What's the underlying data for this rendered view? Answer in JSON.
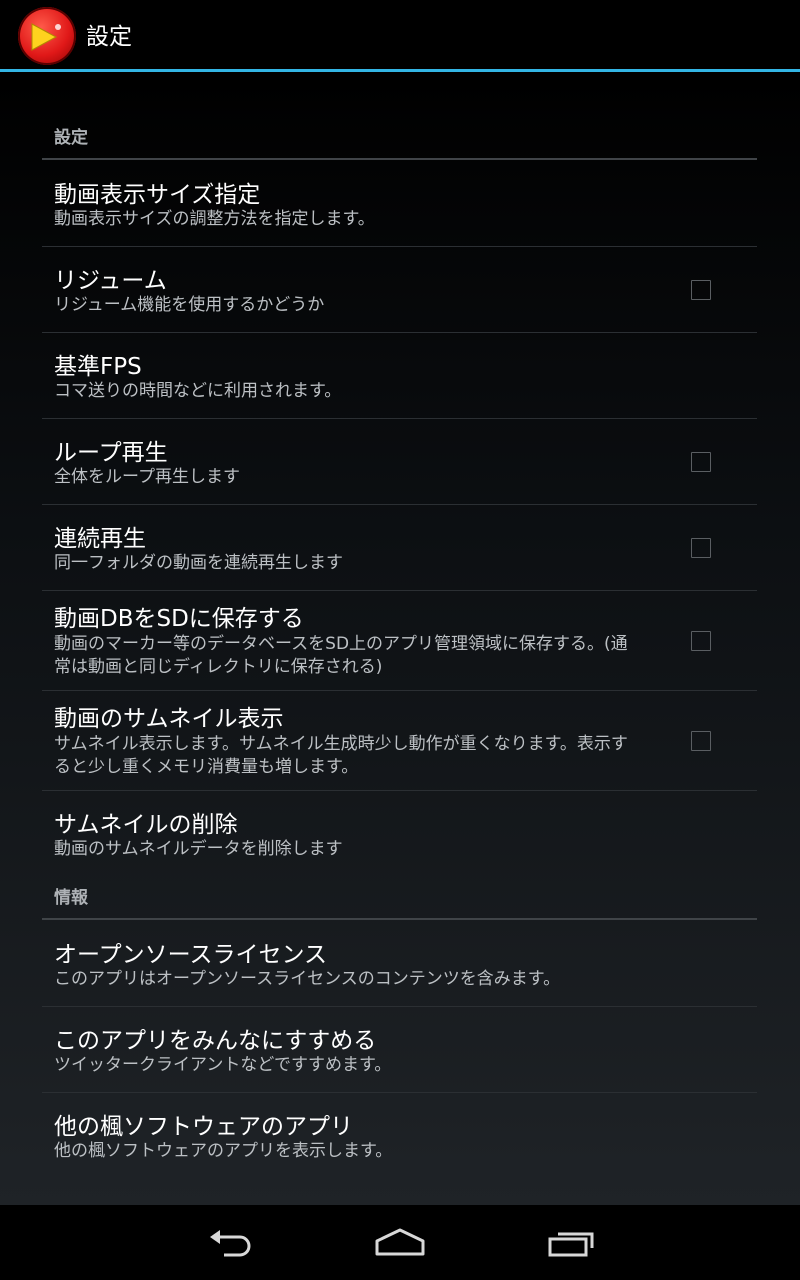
{
  "header": {
    "title": "設定",
    "app_icon": "play-icon",
    "accent_color": "#33b5e5"
  },
  "categories": [
    {
      "label": "設定"
    },
    {
      "label": "情報"
    }
  ],
  "items": [
    {
      "title": "動画表示サイズ指定",
      "summary": "動画表示サイズの調整方法を指定します。",
      "has_checkbox": false,
      "checked": false
    },
    {
      "title": "リジューム",
      "summary": "リジューム機能を使用するかどうか",
      "has_checkbox": true,
      "checked": false
    },
    {
      "title": "基準FPS",
      "summary": "コマ送りの時間などに利用されます。",
      "has_checkbox": false,
      "checked": false
    },
    {
      "title": "ループ再生",
      "summary": "全体をループ再生します",
      "has_checkbox": true,
      "checked": false
    },
    {
      "title": "連続再生",
      "summary": "同一フォルダの動画を連続再生します",
      "has_checkbox": true,
      "checked": false
    },
    {
      "title": "動画DBをSDに保存する",
      "summary": "動画のマーカー等のデータベースをSD上のアプリ管理領域に保存する。(通常は動画と同じディレクトリに保存される)",
      "has_checkbox": true,
      "checked": false
    },
    {
      "title": "動画のサムネイル表示",
      "summary": "サムネイル表示します。サムネイル生成時少し動作が重くなります。表示すると少し重くメモリ消費量も増します。",
      "has_checkbox": true,
      "checked": false
    },
    {
      "title": "サムネイルの削除",
      "summary": "動画のサムネイルデータを削除します",
      "has_checkbox": false,
      "checked": false
    },
    {
      "title": "オープンソースライセンス",
      "summary": "このアプリはオープンソースライセンスのコンテンツを含みます。",
      "has_checkbox": false,
      "checked": false
    },
    {
      "title": "このアプリをみんなにすすめる",
      "summary": "ツイッタークライアントなどですすめます。",
      "has_checkbox": false,
      "checked": false
    },
    {
      "title": "他の楓ソフトウェアのアプリ",
      "summary": "他の楓ソフトウェアのアプリを表示します。",
      "has_checkbox": false,
      "checked": false
    }
  ],
  "navbar": {
    "back_icon": "back-icon",
    "home_icon": "home-icon",
    "recents_icon": "recent-apps-icon"
  }
}
